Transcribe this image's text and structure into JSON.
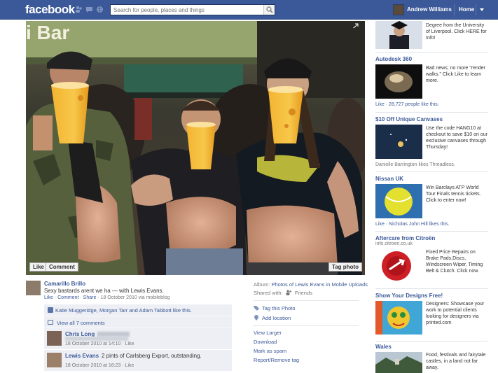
{
  "topbar": {
    "logo": "facebook",
    "search_placeholder": "Search for people, places and things",
    "user_name": "Andrew Williams",
    "home_label": "Home"
  },
  "photo": {
    "like_label": "Like",
    "comment_label": "Comment",
    "tag_label": "Tag photo",
    "sign_text": "i Bar"
  },
  "post": {
    "author": "Camarillo Brillo",
    "caption": "Sexy bastards arent we ha — with Lewis Evans.",
    "meta_like": "Like",
    "meta_comment": "Comment",
    "meta_share": "Share",
    "meta_date": "18 October 2010 via mobileblog",
    "likers": "Katie Muggeridge, Morgan Tarr and Adam Tabbott like this.",
    "view_comments": "View all 7 comments",
    "comments": [
      {
        "name": "Chris Long",
        "text": "",
        "meta": "18 October 2010 at 14:10 · Like"
      },
      {
        "name": "Lewis Evans",
        "text": "2 pints of Carlsberg Export, outstanding.",
        "meta": "18 October 2010 at 16:23 · Like"
      }
    ]
  },
  "album": {
    "album_label": "Album:",
    "album_name": "Photos of Lewis Evans in Mobile Uploads",
    "shared_label": "Shared with:",
    "shared_value": "Friends",
    "tag_this_photo": "Tag this Photo",
    "add_location": "Add location",
    "view_larger": "View Larger",
    "download": "Download",
    "mark_spam": "Mark as spam",
    "report": "Report/Remove tag"
  },
  "ads": [
    {
      "title": "",
      "body": "Degree from the University of Liverpool. Click HERE for Info!",
      "sub": "",
      "social": ""
    },
    {
      "title": "Autodesk 360",
      "body": "Bad news; no more \"render walks.\" Click Like to learn more.",
      "sub": "",
      "social": "Like · 28,727 people like this."
    },
    {
      "title": "$10 Off Unique Canvases",
      "body": "Use the code HANG10 at checkout to save $10 on our exclusive canvases through Thursday!",
      "sub": "",
      "social": "Danielle Barrington likes Threadless."
    },
    {
      "title": "Nissan UK",
      "body": "Win Barclays ATP World Tour Finals tennis tickets. Click to enter now!",
      "sub": "",
      "social": "Like · Nicholas John Hill likes this."
    },
    {
      "title": "Aftercare from Citroën",
      "body": "Fixed Price Repairs on Brake Pads,Discs, Windscreen Wiper, Timing Belt & Clutch. Click now.",
      "sub": "info.citroen.co.uk",
      "social": ""
    },
    {
      "title": "Show Your Designs Free!",
      "body": "Designers: Showcase your work to potential clients looking for designers via printed.com",
      "sub": "",
      "social": ""
    },
    {
      "title": "Wales",
      "body": "Food, festivals and fairytale castles, in a land not far away.",
      "sub": "",
      "social": ""
    }
  ],
  "colors": {
    "brand": "#3b5998",
    "comment_bg": "#edeff4"
  }
}
